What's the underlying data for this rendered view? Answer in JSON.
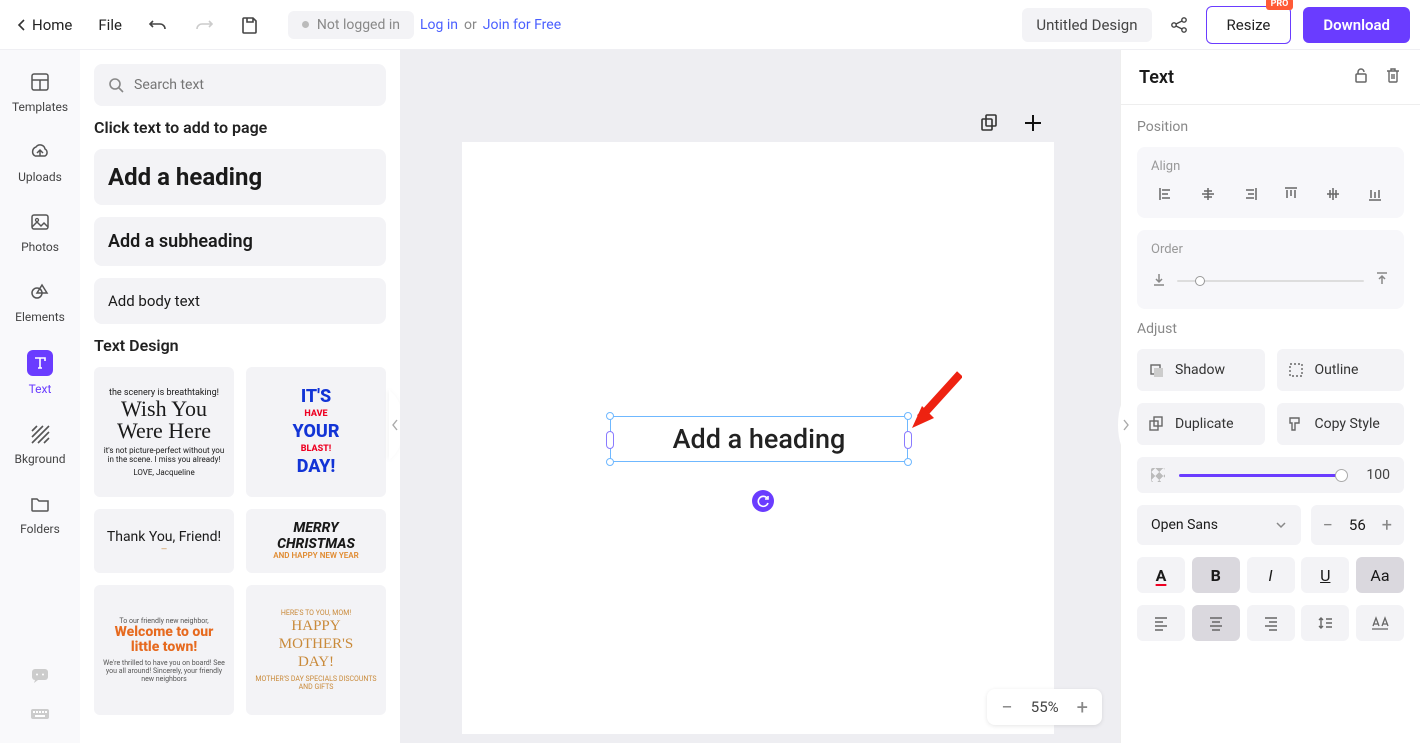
{
  "topbar": {
    "home": "Home",
    "file": "File",
    "not_logged": "Not logged in",
    "login": "Log in",
    "or": "or",
    "join": "Join for Free",
    "title": "Untitled Design",
    "resize": "Resize",
    "pro": "PRO",
    "download": "Download"
  },
  "sidebar": {
    "templates": "Templates",
    "uploads": "Uploads",
    "photos": "Photos",
    "elements": "Elements",
    "text": "Text",
    "bkground": "Bkground",
    "folders": "Folders"
  },
  "panel": {
    "search_placeholder": "Search text",
    "title": "Click text to add to page",
    "heading": "Add a heading",
    "subheading": "Add a subheading",
    "body": "Add body text",
    "design_title": "Text Design",
    "cards": {
      "c1": {
        "l1": "the scenery is breathtaking!",
        "l2a": "Wish You",
        "l2b": "Were Here",
        "l3": "it's not picture-perfect without you in the scene. I miss you already!",
        "l4": "LOVE,\nJacqueline"
      },
      "c2": {
        "l1": "IT'S",
        "l2": "HAVE",
        "l3": "YOUR",
        "l4": "BLAST!",
        "l5": "DAY!"
      },
      "c3": {
        "l1": "Thank You, Friend!",
        "l2": "—"
      },
      "c4": {
        "l1": "MERRY",
        "l2": "CHRISTMAS",
        "l3": "AND HAPPY NEW YEAR"
      },
      "c5": {
        "s1": "To our friendly new neighbor,",
        "t1": "Welcome to our",
        "t2": "little town!",
        "s2": "We're thrilled to have you on board! See you all around!\nSincerely, your friendly new neighbors"
      },
      "c6": {
        "s1": "HERE'S TO YOU, MOM!",
        "t1": "HAPPY",
        "t2": "MOTHER'S",
        "t3": "DAY!",
        "s2": "MOTHER'S DAY SPECIALS\nDISCOUNTS AND GIFTS"
      }
    }
  },
  "canvas": {
    "selected_text": "Add a heading",
    "zoom": "55%"
  },
  "props": {
    "title": "Text",
    "position": "Position",
    "align": "Align",
    "order": "Order",
    "adjust": "Adjust",
    "shadow": "Shadow",
    "outline": "Outline",
    "duplicate": "Duplicate",
    "copy_style": "Copy Style",
    "opacity": "100",
    "font": "Open Sans",
    "size": "56"
  }
}
